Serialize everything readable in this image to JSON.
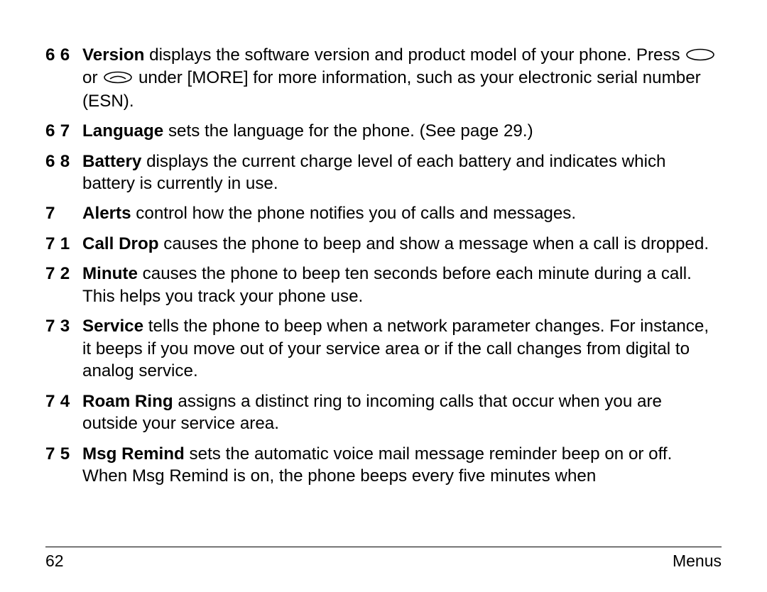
{
  "entries": [
    {
      "num": "6 6",
      "term": "Version",
      "text_before": " displays the software version and product model of your phone. Press ",
      "icon1": true,
      "mid": " or ",
      "icon2": true,
      "text_after": " under [MORE] for more information, such as your electronic serial number (ESN)."
    },
    {
      "num": "6 7",
      "term": "Language",
      "text": " sets the language for the phone. (See page 29.)"
    },
    {
      "num": "6 8",
      "term": "Battery",
      "text": " displays the current charge level of each battery and indicates which battery is currently in use."
    },
    {
      "num": "7",
      "term": "Alerts",
      "text": " control how the phone notifies you of calls and messages."
    },
    {
      "num": "7 1",
      "term": "Call Drop",
      "text": " causes the phone to beep and show a message when a call is dropped."
    },
    {
      "num": "7 2",
      "term": "Minute",
      "text": " causes the phone to beep ten seconds before each minute during a call. This helps you track your phone use."
    },
    {
      "num": "7 3",
      "term": "Service",
      "text": " tells the phone to beep when a network parameter changes. For instance, it beeps if you move out of your service area or if the call changes from digital to analog service."
    },
    {
      "num": "7 4",
      "term": "Roam Ring",
      "text": " assigns a distinct ring to incoming calls that occur when you are outside your service area."
    },
    {
      "num": "7 5",
      "term": "Msg Remind",
      "text": " sets the automatic voice mail message reminder beep on or off. When Msg Remind is on, the phone beeps every five minutes when"
    }
  ],
  "footer": {
    "page": "62",
    "section": "Menus"
  }
}
